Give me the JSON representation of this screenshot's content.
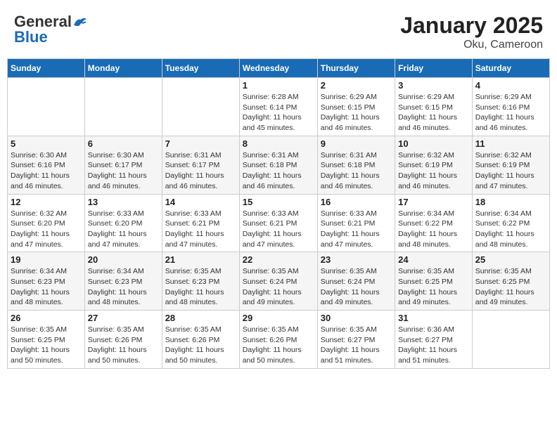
{
  "header": {
    "logo_general": "General",
    "logo_blue": "Blue",
    "title": "January 2025",
    "subtitle": "Oku, Cameroon"
  },
  "weekdays": [
    "Sunday",
    "Monday",
    "Tuesday",
    "Wednesday",
    "Thursday",
    "Friday",
    "Saturday"
  ],
  "weeks": [
    [
      {
        "day": "",
        "info": ""
      },
      {
        "day": "",
        "info": ""
      },
      {
        "day": "",
        "info": ""
      },
      {
        "day": "1",
        "info": "Sunrise: 6:28 AM\nSunset: 6:14 PM\nDaylight: 11 hours and 45 minutes."
      },
      {
        "day": "2",
        "info": "Sunrise: 6:29 AM\nSunset: 6:15 PM\nDaylight: 11 hours and 46 minutes."
      },
      {
        "day": "3",
        "info": "Sunrise: 6:29 AM\nSunset: 6:15 PM\nDaylight: 11 hours and 46 minutes."
      },
      {
        "day": "4",
        "info": "Sunrise: 6:29 AM\nSunset: 6:16 PM\nDaylight: 11 hours and 46 minutes."
      }
    ],
    [
      {
        "day": "5",
        "info": "Sunrise: 6:30 AM\nSunset: 6:16 PM\nDaylight: 11 hours and 46 minutes."
      },
      {
        "day": "6",
        "info": "Sunrise: 6:30 AM\nSunset: 6:17 PM\nDaylight: 11 hours and 46 minutes."
      },
      {
        "day": "7",
        "info": "Sunrise: 6:31 AM\nSunset: 6:17 PM\nDaylight: 11 hours and 46 minutes."
      },
      {
        "day": "8",
        "info": "Sunrise: 6:31 AM\nSunset: 6:18 PM\nDaylight: 11 hours and 46 minutes."
      },
      {
        "day": "9",
        "info": "Sunrise: 6:31 AM\nSunset: 6:18 PM\nDaylight: 11 hours and 46 minutes."
      },
      {
        "day": "10",
        "info": "Sunrise: 6:32 AM\nSunset: 6:19 PM\nDaylight: 11 hours and 46 minutes."
      },
      {
        "day": "11",
        "info": "Sunrise: 6:32 AM\nSunset: 6:19 PM\nDaylight: 11 hours and 47 minutes."
      }
    ],
    [
      {
        "day": "12",
        "info": "Sunrise: 6:32 AM\nSunset: 6:20 PM\nDaylight: 11 hours and 47 minutes."
      },
      {
        "day": "13",
        "info": "Sunrise: 6:33 AM\nSunset: 6:20 PM\nDaylight: 11 hours and 47 minutes."
      },
      {
        "day": "14",
        "info": "Sunrise: 6:33 AM\nSunset: 6:21 PM\nDaylight: 11 hours and 47 minutes."
      },
      {
        "day": "15",
        "info": "Sunrise: 6:33 AM\nSunset: 6:21 PM\nDaylight: 11 hours and 47 minutes."
      },
      {
        "day": "16",
        "info": "Sunrise: 6:33 AM\nSunset: 6:21 PM\nDaylight: 11 hours and 47 minutes."
      },
      {
        "day": "17",
        "info": "Sunrise: 6:34 AM\nSunset: 6:22 PM\nDaylight: 11 hours and 48 minutes."
      },
      {
        "day": "18",
        "info": "Sunrise: 6:34 AM\nSunset: 6:22 PM\nDaylight: 11 hours and 48 minutes."
      }
    ],
    [
      {
        "day": "19",
        "info": "Sunrise: 6:34 AM\nSunset: 6:23 PM\nDaylight: 11 hours and 48 minutes."
      },
      {
        "day": "20",
        "info": "Sunrise: 6:34 AM\nSunset: 6:23 PM\nDaylight: 11 hours and 48 minutes."
      },
      {
        "day": "21",
        "info": "Sunrise: 6:35 AM\nSunset: 6:23 PM\nDaylight: 11 hours and 48 minutes."
      },
      {
        "day": "22",
        "info": "Sunrise: 6:35 AM\nSunset: 6:24 PM\nDaylight: 11 hours and 49 minutes."
      },
      {
        "day": "23",
        "info": "Sunrise: 6:35 AM\nSunset: 6:24 PM\nDaylight: 11 hours and 49 minutes."
      },
      {
        "day": "24",
        "info": "Sunrise: 6:35 AM\nSunset: 6:25 PM\nDaylight: 11 hours and 49 minutes."
      },
      {
        "day": "25",
        "info": "Sunrise: 6:35 AM\nSunset: 6:25 PM\nDaylight: 11 hours and 49 minutes."
      }
    ],
    [
      {
        "day": "26",
        "info": "Sunrise: 6:35 AM\nSunset: 6:25 PM\nDaylight: 11 hours and 50 minutes."
      },
      {
        "day": "27",
        "info": "Sunrise: 6:35 AM\nSunset: 6:26 PM\nDaylight: 11 hours and 50 minutes."
      },
      {
        "day": "28",
        "info": "Sunrise: 6:35 AM\nSunset: 6:26 PM\nDaylight: 11 hours and 50 minutes."
      },
      {
        "day": "29",
        "info": "Sunrise: 6:35 AM\nSunset: 6:26 PM\nDaylight: 11 hours and 50 minutes."
      },
      {
        "day": "30",
        "info": "Sunrise: 6:35 AM\nSunset: 6:27 PM\nDaylight: 11 hours and 51 minutes."
      },
      {
        "day": "31",
        "info": "Sunrise: 6:36 AM\nSunset: 6:27 PM\nDaylight: 11 hours and 51 minutes."
      },
      {
        "day": "",
        "info": ""
      }
    ]
  ]
}
